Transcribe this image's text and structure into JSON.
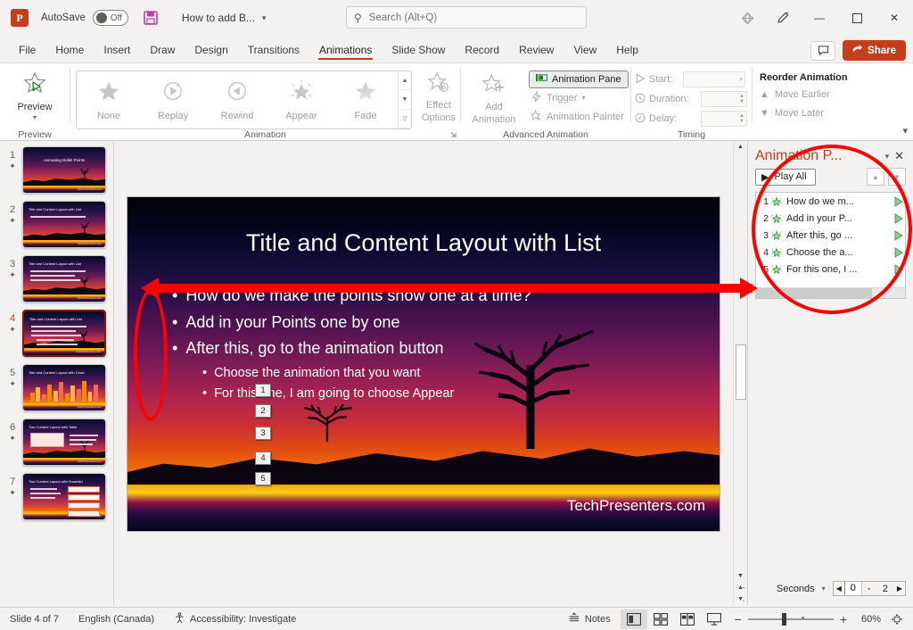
{
  "titlebar": {
    "logo": "P",
    "autosave_label": "AutoSave",
    "autosave_state": "Off",
    "save_icon": "save-icon",
    "document_title": "How to add B...",
    "search_placeholder": "Search (Alt+Q)",
    "diamond_icon": "diamond-icon",
    "pen_icon": "pen-icon",
    "minimize": "—",
    "maximize": "☐",
    "close": "✕"
  },
  "tabs": [
    {
      "label": "File",
      "active": false
    },
    {
      "label": "Home",
      "active": false
    },
    {
      "label": "Insert",
      "active": false
    },
    {
      "label": "Draw",
      "active": false
    },
    {
      "label": "Design",
      "active": false
    },
    {
      "label": "Transitions",
      "active": false
    },
    {
      "label": "Animations",
      "active": true
    },
    {
      "label": "Slide Show",
      "active": false
    },
    {
      "label": "Record",
      "active": false
    },
    {
      "label": "Review",
      "active": false
    },
    {
      "label": "View",
      "active": false
    },
    {
      "label": "Help",
      "active": false
    }
  ],
  "tabbar_right": {
    "comment_icon": "comment-icon",
    "share_label": "Share"
  },
  "ribbon": {
    "preview": {
      "button_label": "Preview",
      "group_label": "Preview"
    },
    "animation": {
      "group_label": "Animation",
      "gallery": [
        {
          "label": "None",
          "icon": "star-outline-icon"
        },
        {
          "label": "Replay",
          "icon": "replay-icon"
        },
        {
          "label": "Rewind",
          "icon": "rewind-icon"
        },
        {
          "label": "Appear",
          "icon": "star-burst-icon"
        },
        {
          "label": "Fade",
          "icon": "star-fade-icon"
        }
      ],
      "effect_options_line1": "Effect",
      "effect_options_line2": "Options"
    },
    "advanced": {
      "group_label": "Advanced Animation",
      "add_animation_line1": "Add",
      "add_animation_line2": "Animation",
      "animation_pane_label": "Animation Pane",
      "trigger_label": "Trigger",
      "animation_painter_label": "Animation Painter"
    },
    "timing": {
      "group_label": "Timing",
      "start_label": "Start:",
      "start_value": "",
      "duration_label": "Duration:",
      "duration_value": "",
      "delay_label": "Delay:",
      "delay_value": ""
    },
    "reorder": {
      "title": "Reorder Animation",
      "move_earlier": "Move Earlier",
      "move_later": "Move Later"
    }
  },
  "thumbnails": [
    {
      "number": "1",
      "title": "Animating Bullet Points",
      "selected": false,
      "kind": "title"
    },
    {
      "number": "2",
      "title": "Title and Content Layout with List",
      "selected": false,
      "kind": "list",
      "lines": 1
    },
    {
      "number": "3",
      "title": "Title and Content Layout with List",
      "selected": false,
      "kind": "list",
      "lines": 3
    },
    {
      "number": "4",
      "title": "Title and Content Layout with List",
      "selected": true,
      "kind": "list",
      "lines": 5
    },
    {
      "number": "5",
      "title": "Title and Content Layout with Chart",
      "selected": false,
      "kind": "chart"
    },
    {
      "number": "6",
      "title": "Two Content Layout with Table",
      "selected": false,
      "kind": "table"
    },
    {
      "number": "7",
      "title": "Two Content Layout with SmartArt",
      "selected": false,
      "kind": "smartart"
    }
  ],
  "slide": {
    "title": "Title and Content Layout with List",
    "bullets_level1": [
      "How do we make the points show one at a time?",
      "Add in your Points one by one",
      "After this, go to the animation button"
    ],
    "bullets_level2": [
      "Choose the animation that you want",
      "For this one, I am going to choose Appear"
    ],
    "watermark": "TechPresenters.com",
    "animation_tags": [
      "1",
      "2",
      "3",
      "4",
      "5"
    ],
    "bullet_glyph": "•"
  },
  "animation_pane": {
    "title": "Animation P...",
    "close_icon": "close-icon",
    "caret_icon": "chevron-down-icon",
    "play_all_label": "Play All",
    "up_arrow": "▲",
    "down_arrow": "▼",
    "items": [
      {
        "index": "1",
        "text": "How do we m..."
      },
      {
        "index": "2",
        "text": "Add in your P..."
      },
      {
        "index": "3",
        "text": "After this, go ..."
      },
      {
        "index": "4",
        "text": "Choose the a..."
      },
      {
        "index": "5",
        "text": "For this one, I ..."
      }
    ],
    "seconds_label": "Seconds",
    "sec_start": "0",
    "sec_end": "2"
  },
  "statusbar": {
    "slide_counter": "Slide 4 of 7",
    "language": "English (Canada)",
    "accessibility": "Accessibility: Investigate",
    "notes_label": "Notes",
    "views": [
      {
        "name": "normal-view",
        "active": true
      },
      {
        "name": "slide-sorter-view",
        "active": false
      },
      {
        "name": "reading-view",
        "active": false
      },
      {
        "name": "slide-show-view",
        "active": false
      }
    ],
    "zoom_out": "−",
    "zoom_in": "+",
    "zoom_level": "60%",
    "fit_icon": "fit-slide-icon"
  },
  "colors": {
    "accent": "#c43e1c",
    "annotation": "#ff0000",
    "ribbon_bg": "#ffffff",
    "chrome_bg": "#f3f2f1"
  }
}
